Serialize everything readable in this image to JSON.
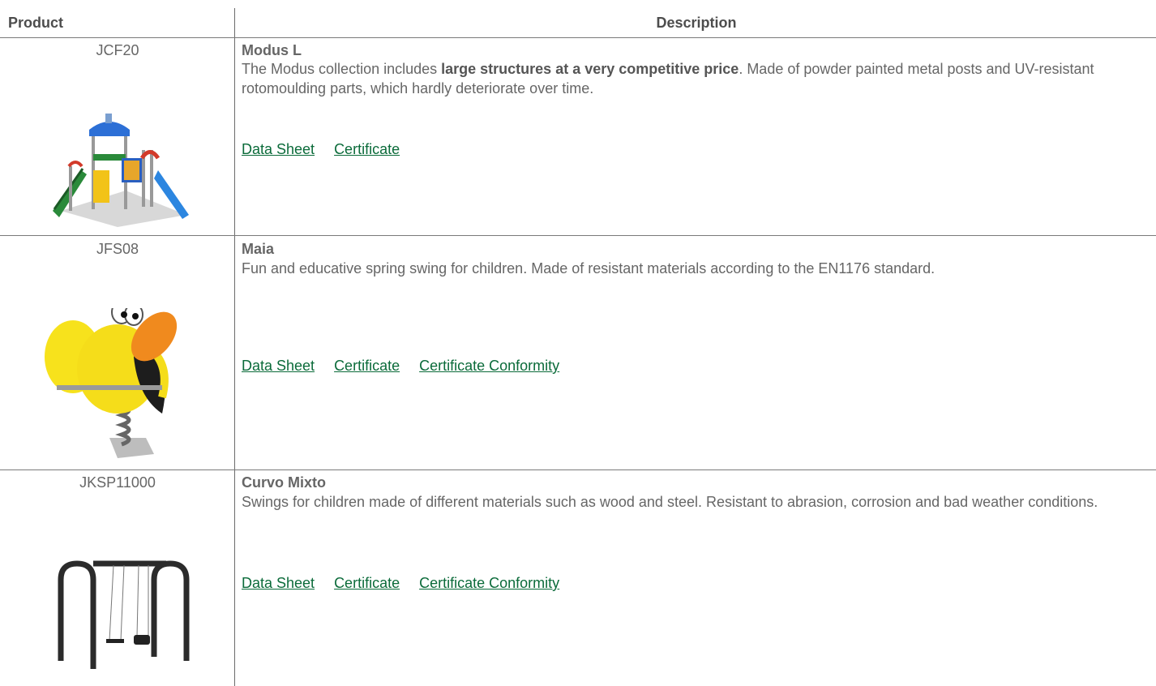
{
  "table": {
    "headers": {
      "product": "Product",
      "description": "Description"
    },
    "rows": [
      {
        "code": "JCF20",
        "name": "Modus L",
        "desc_pre": "The Modus collection includes ",
        "desc_bold": "large structures at a very competitive price",
        "desc_post": ". Made of powder painted metal posts and UV-resistant rotomoulding parts, which hardly deteriorate over time.",
        "links": [
          "Data Sheet",
          "Certificate"
        ],
        "image_icon": "playground-structure-image"
      },
      {
        "code": "JFS08",
        "name": "Maia",
        "desc": "Fun and educative spring swing for children. Made of resistant materials according to the EN1176 standard.",
        "links": [
          "Data Sheet",
          "Certificate",
          "Certificate Conformity"
        ],
        "image_icon": "bee-spring-rider-image"
      },
      {
        "code": "JKSP11000",
        "name": "Curvo Mixto",
        "desc": "Swings for children made of different materials such as wood and steel. Resistant to abrasion, corrosion and bad weather conditions.",
        "links": [
          "Data Sheet",
          "Certificate",
          "Certificate Conformity"
        ],
        "image_icon": "swing-set-image"
      }
    ]
  },
  "colors": {
    "link": "#0b6b3a",
    "text": "#666666",
    "border": "#6b6b6b"
  }
}
